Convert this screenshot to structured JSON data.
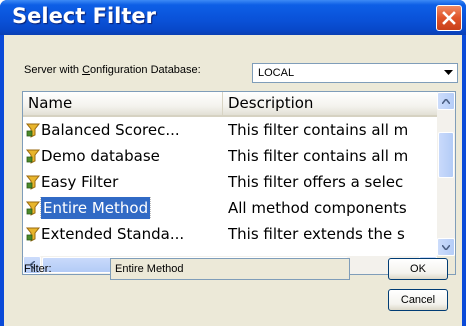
{
  "window": {
    "title": "Select Filter"
  },
  "server": {
    "label_prefix": "Server with ",
    "label_access_key": "C",
    "label_suffix": "onfiguration Database:",
    "value": "LOCAL"
  },
  "list": {
    "columns": [
      "Name",
      "Description"
    ],
    "rows": [
      {
        "name": "Balanced Scorec...",
        "description": "This filter contains all m",
        "selected": false
      },
      {
        "name": "Demo database",
        "description": "This filter contains all m",
        "selected": false
      },
      {
        "name": "Easy Filter",
        "description": "This filter offers a selec",
        "selected": false
      },
      {
        "name": "Entire Method",
        "description": "All method components",
        "selected": true
      },
      {
        "name": "Extended Standa...",
        "description": "This filter extends the s",
        "selected": false
      }
    ]
  },
  "filter": {
    "label": "Filter:",
    "value": "Entire Method"
  },
  "buttons": {
    "ok": "OK",
    "cancel": "Cancel"
  },
  "colors": {
    "titlebar": "#0a52d9",
    "selection": "#316ac5",
    "face": "#ece9d8",
    "close": "#e0542a"
  },
  "icons": {
    "row": "filter-icon",
    "close": "close-icon"
  }
}
